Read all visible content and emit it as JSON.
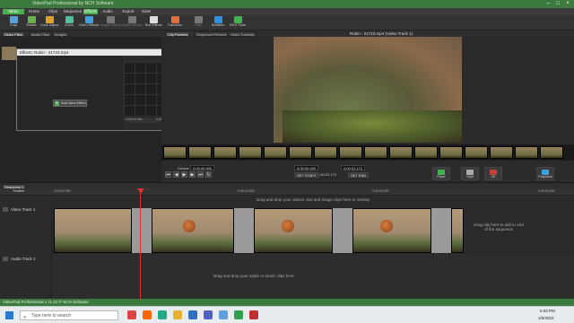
{
  "titlebar": {
    "title": "VideoPad Professional by NCH Software"
  },
  "menu": {
    "items": [
      "Menu",
      "Home",
      "Clips",
      "Sequence",
      "Effects",
      "Audio",
      "Export",
      "Suite"
    ],
    "active": "Effects"
  },
  "ribbon": {
    "buttons": [
      {
        "label": "Crop",
        "color": "#5aa0d8"
      },
      {
        "label": "Rotate",
        "color": "#6ab04c"
      },
      {
        "label": "Color Adjust",
        "color": "#e0a030"
      },
      {
        "label": "Zoom",
        "color": "#50c0a0"
      },
      {
        "label": "Video Effects",
        "color": "#40a0e0"
      },
      {
        "label": "Image Effects",
        "color": "#777777",
        "dim": true
      },
      {
        "label": "Audio Effects",
        "color": "#777777",
        "dim": true
      },
      {
        "label": "Text Effects",
        "color": "#dddddd"
      },
      {
        "label": "Transition",
        "color": "#e07040"
      },
      {
        "label": "Fade",
        "color": "#777777",
        "dim": true
      },
      {
        "label": "Subtitles",
        "color": "#3090e0"
      },
      {
        "label": "NCH Suite",
        "color": "#40b050"
      }
    ]
  },
  "bin_tabs": [
    "Video Files",
    "Audio Files",
    "Images"
  ],
  "effects_window": {
    "title": "Effects: Robin - 21723.mp4",
    "add_button": "Add New Effect",
    "graph_ticks": [
      "0:00:00.000",
      "0:00:12.000",
      "0:00:24.000"
    ]
  },
  "preview": {
    "tabs": [
      "Clip Preview",
      "Sequence Preview",
      "Video Tutorials"
    ],
    "title": "Robin - 21723.mp4 (Video Track 1)"
  },
  "transport": {
    "cursor_label": "Cursor:",
    "cursor_value": "0:00:00.000",
    "in_value": "0:00:00.000",
    "out_value": "0:00:31.172",
    "duration": "0:00:31.172",
    "set_start": "SET START",
    "set_end": "SET END",
    "actions": [
      {
        "label": "Place",
        "color": "#40b050"
      },
      {
        "label": "Split",
        "color": "#aaaaaa"
      },
      {
        "label": "3D",
        "color": "#c04040"
      },
      {
        "label": "Playback",
        "color": "#40a0e0"
      }
    ]
  },
  "sequence": {
    "tab": "Sequence 1",
    "timeline_label": "Timeline",
    "ruler_ticks": [
      "0:00:00.000",
      "0:00:10.000",
      "0:00:20.000",
      "0:00:30.000"
    ],
    "video_track": "Video Track 1",
    "audio_track": "Audio Track 1",
    "video_overlay_hint": "Drag and drop your videos, text and image clips here to overlay",
    "drag_end_hint": "Drag clip here to add to end of the sequence",
    "audio_hint": "Drag and drop your audio or music clips here"
  },
  "statusbar": {
    "text": "VideoPad Professional v 11.22 © NCH Software"
  },
  "taskbar": {
    "search_placeholder": "Type here to search",
    "time": "5:03 PM",
    "date": "1/5/2022",
    "apps": [
      {
        "name": "chrome-icon",
        "color": "#d44"
      },
      {
        "name": "brave-icon",
        "color": "#f60"
      },
      {
        "name": "edge-icon",
        "color": "#2a8"
      },
      {
        "name": "explorer-icon",
        "color": "#e8b030"
      },
      {
        "name": "mail-icon",
        "color": "#3070c0"
      },
      {
        "name": "teams-icon",
        "color": "#5060c0"
      },
      {
        "name": "store-icon",
        "color": "#60a0e0"
      },
      {
        "name": "camtasia-icon",
        "color": "#30a050"
      },
      {
        "name": "videopad-icon",
        "color": "#c03030"
      }
    ]
  }
}
